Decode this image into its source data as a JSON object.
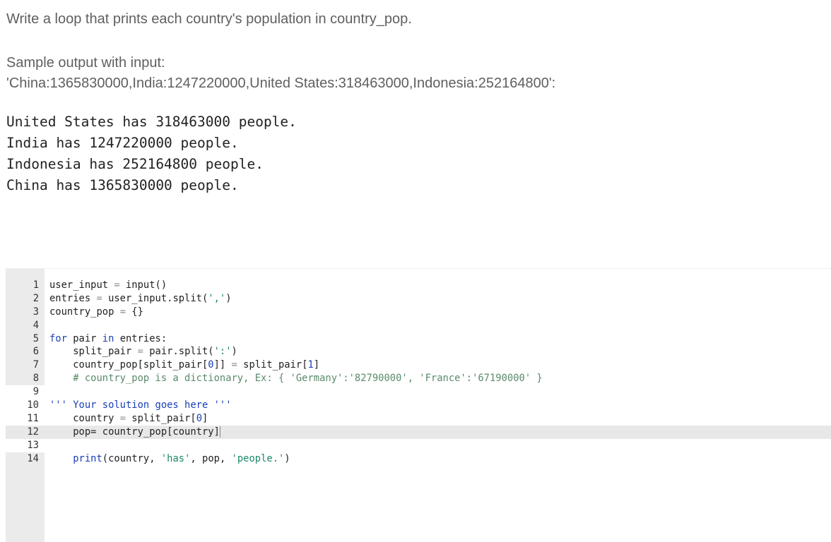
{
  "prompt": "Write a loop that prints each country's population in country_pop.",
  "sample_label": "Sample output with input:",
  "sample_input": "'China:1365830000,India:1247220000,United States:318463000,Indonesia:252164800':",
  "output_lines": [
    "United States has 318463000 people.",
    "India has 1247220000 people.",
    "Indonesia has 252164800 people.",
    "China has 1365830000 people."
  ],
  "editor": {
    "active_line": 12,
    "lines": [
      {
        "n": "1",
        "tokens": [
          [
            "user_input ",
            ""
          ],
          [
            "=",
            "op"
          ],
          [
            " input()",
            ""
          ]
        ]
      },
      {
        "n": "2",
        "tokens": [
          [
            "entries ",
            ""
          ],
          [
            "=",
            "op"
          ],
          [
            " user_input.split(",
            ""
          ],
          [
            "','",
            "str"
          ],
          [
            ")",
            ""
          ]
        ]
      },
      {
        "n": "3",
        "tokens": [
          [
            "country_pop ",
            ""
          ],
          [
            "=",
            "op"
          ],
          [
            " {}",
            ""
          ]
        ]
      },
      {
        "n": "4",
        "tokens": []
      },
      {
        "n": "5",
        "tokens": [
          [
            "for",
            "kw"
          ],
          [
            " pair ",
            ""
          ],
          [
            "in",
            "kw"
          ],
          [
            " entries:",
            ""
          ]
        ]
      },
      {
        "n": "6",
        "tokens": [
          [
            "    split_pair ",
            ""
          ],
          [
            "=",
            "op"
          ],
          [
            " pair.split(",
            ""
          ],
          [
            "':'",
            "str"
          ],
          [
            ")",
            ""
          ]
        ]
      },
      {
        "n": "7",
        "tokens": [
          [
            "    country_pop[split_pair[",
            ""
          ],
          [
            "0",
            "num"
          ],
          [
            "]] ",
            ""
          ],
          [
            "=",
            "op"
          ],
          [
            " split_pair[",
            ""
          ],
          [
            "1",
            "num"
          ],
          [
            "]",
            ""
          ]
        ]
      },
      {
        "n": "8",
        "tokens": [
          [
            "    # country_pop is a dictionary, Ex: { 'Germany':'82790000', 'France':'67190000' }",
            "cm"
          ]
        ]
      },
      {
        "n": "9",
        "tokens": []
      },
      {
        "n": "10",
        "tokens": [
          [
            "''' Your solution goes here '''",
            "kw"
          ]
        ]
      },
      {
        "n": "11",
        "tokens": [
          [
            "    country ",
            ""
          ],
          [
            "=",
            "op"
          ],
          [
            " split_pair[",
            ""
          ],
          [
            "0",
            "num"
          ],
          [
            "]",
            ""
          ]
        ]
      },
      {
        "n": "12",
        "tokens": [
          [
            "    pop= country_pop[country]",
            ""
          ]
        ]
      },
      {
        "n": "13",
        "tokens": []
      },
      {
        "n": "14",
        "tokens": [
          [
            "    ",
            ""
          ],
          [
            "print",
            "kw"
          ],
          [
            "(country, ",
            ""
          ],
          [
            "'has'",
            "str"
          ],
          [
            ", pop, ",
            ""
          ],
          [
            "'people.'",
            "str"
          ],
          [
            ")",
            ""
          ]
        ]
      }
    ]
  }
}
